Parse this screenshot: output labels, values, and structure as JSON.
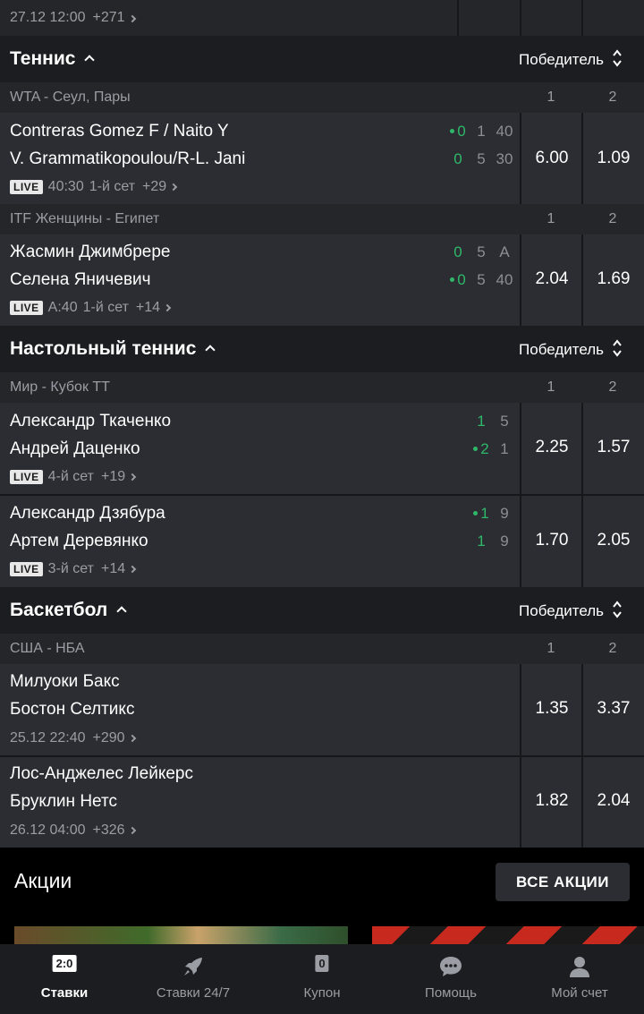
{
  "top_strip": {
    "datetime": "27.12 12:00",
    "more": "+271"
  },
  "sections": {
    "tennis": {
      "title": "Теннис",
      "market": "Победитель"
    },
    "table_tennis": {
      "title": "Настольный теннис",
      "market": "Победитель"
    },
    "basketball": {
      "title": "Баскетбол",
      "market": "Победитель"
    }
  },
  "columns": {
    "c1": "1",
    "c2": "2"
  },
  "leagues": {
    "wta": "WTA - Сеул, Пары",
    "itf": "ITF Женщины - Египет",
    "tt": "Мир - Кубок ТТ",
    "nba": "США - НБА"
  },
  "live_label": "LIVE",
  "matches": {
    "m1": {
      "team1": "Contreras Gomez F / Naito Y",
      "team2": "V. Grammatikopoulou/R-L. Jani",
      "score1": [
        "0",
        "1",
        "40"
      ],
      "score2": [
        "0",
        "5",
        "30"
      ],
      "status": "40:30",
      "period": "1-й сет",
      "more": "+29",
      "odd1": "6.00",
      "odd2": "1.09"
    },
    "m2": {
      "team1": "Жасмин Джимбрере",
      "team2": "Селена Яничевич",
      "score1": [
        "0",
        "5",
        "A"
      ],
      "score2": [
        "0",
        "5",
        "40"
      ],
      "status": "A:40",
      "period": "1-й сет",
      "more": "+14",
      "odd1": "2.04",
      "odd2": "1.69"
    },
    "m3": {
      "team1": "Александр Ткаченко",
      "team2": "Андрей Даценко",
      "score1": [
        "1",
        "5"
      ],
      "score2": [
        "2",
        "1"
      ],
      "period": "4-й сет",
      "more": "+19",
      "odd1": "2.25",
      "odd2": "1.57"
    },
    "m4": {
      "team1": "Александр Дзябура",
      "team2": "Артем Деревянко",
      "score1": [
        "1",
        "9"
      ],
      "score2": [
        "1",
        "9"
      ],
      "period": "3-й сет",
      "more": "+14",
      "odd1": "1.70",
      "odd2": "2.05"
    },
    "m5": {
      "team1": "Милуоки Бакс",
      "team2": "Бостон Селтикс",
      "datetime": "25.12 22:40",
      "more": "+290",
      "odd1": "1.35",
      "odd2": "3.37"
    },
    "m6": {
      "team1": "Лос-Анджелес Лейкерс",
      "team2": "Бруклин Нетс",
      "datetime": "26.12 04:00",
      "more": "+326",
      "odd1": "1.82",
      "odd2": "2.04"
    }
  },
  "promo": {
    "title": "Акции",
    "button": "ВСЕ АКЦИИ"
  },
  "nav": {
    "bets": {
      "label": "Ставки",
      "badge": "2:0"
    },
    "bets247": {
      "label": "Ставки 24/7"
    },
    "coupon": {
      "label": "Купон",
      "badge": "0"
    },
    "help": {
      "label": "Помощь"
    },
    "account": {
      "label": "Мой счет"
    }
  },
  "colors": {
    "accent_green": "#2fb86a",
    "row_bg": "#2b2d32",
    "header_bg": "#1c1d20"
  }
}
